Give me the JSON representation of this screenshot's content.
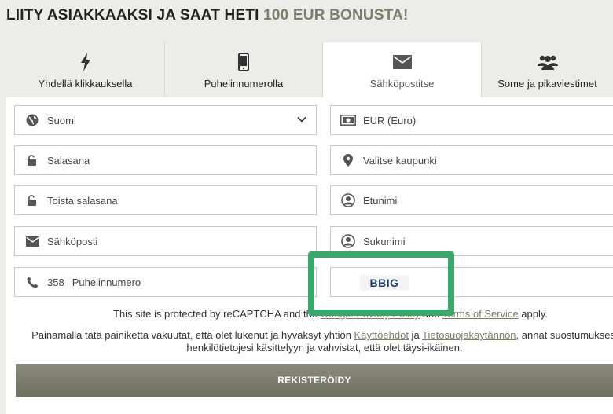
{
  "headline": {
    "main": "LIITY ASIAKKAAKSI JA SAAT HETI ",
    "accent": "100 EUR BONUSTA!"
  },
  "tabs": [
    {
      "label": "Yhdellä klikkauksella",
      "icon": "lightning-icon",
      "active": false
    },
    {
      "label": "Puhelinnumerolla",
      "icon": "phone-icon",
      "active": false
    },
    {
      "label": "Sähköpostitse",
      "icon": "envelope-icon",
      "active": true
    },
    {
      "label": "Some ja pikaviestimet",
      "icon": "users-icon",
      "active": false
    }
  ],
  "form": {
    "country": "Suomi",
    "currency": "EUR (Euro)",
    "password_placeholder": "Salasana",
    "city_placeholder": "Valitse kaupunki",
    "password_repeat_placeholder": "Toista salasana",
    "firstname_placeholder": "Etunimi",
    "email_placeholder": "Sähköposti",
    "lastname_placeholder": "Sukunimi",
    "phone_code": "358",
    "phone_placeholder": "Puhelinnumero",
    "promo_code": "BBIG"
  },
  "recaptcha": {
    "prefix": "This site is protected by reCAPTCHA and the ",
    "privacy_link": "Google Privacy Policy",
    "middle": " and ",
    "terms_link": "Terms of Service",
    "suffix": " apply."
  },
  "terms": {
    "prefix": "Painamalla tätä painiketta vakuutat, että olet lukenut ja hyväksyt yhtiön ",
    "link1": "Käyttöehdot",
    "middle": " ja ",
    "link2": "Tietosuojakäytännön",
    "suffix": ", annat suostumuksesi henkilötietojesi käsittelyyn ja vahvistat, että olet täysi-ikäinen."
  },
  "submit_label": "REKISTERÖIDY",
  "colors": {
    "accent": "#7c7d6c",
    "highlight": "#3aa86a",
    "button": "#7a7b6b"
  }
}
